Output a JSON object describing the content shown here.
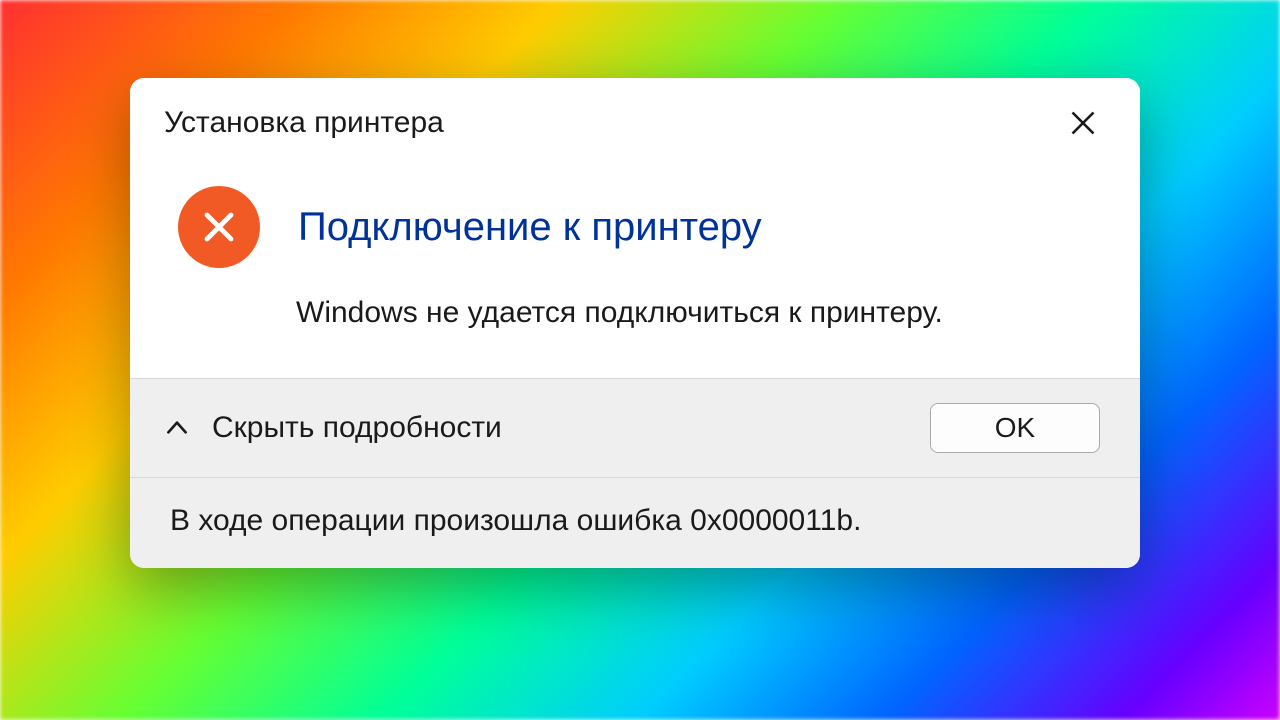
{
  "dialog": {
    "title": "Установка принтера",
    "heading": "Подключение к принтеру",
    "message": "Windows не удается подключиться к принтеру.",
    "details_toggle_label": "Скрыть подробности",
    "ok_label": "OK",
    "details_text": "В ходе операции произошла ошибка 0x0000011b."
  },
  "colors": {
    "accent_heading": "#003399",
    "error_icon_bg": "#f15a24"
  }
}
